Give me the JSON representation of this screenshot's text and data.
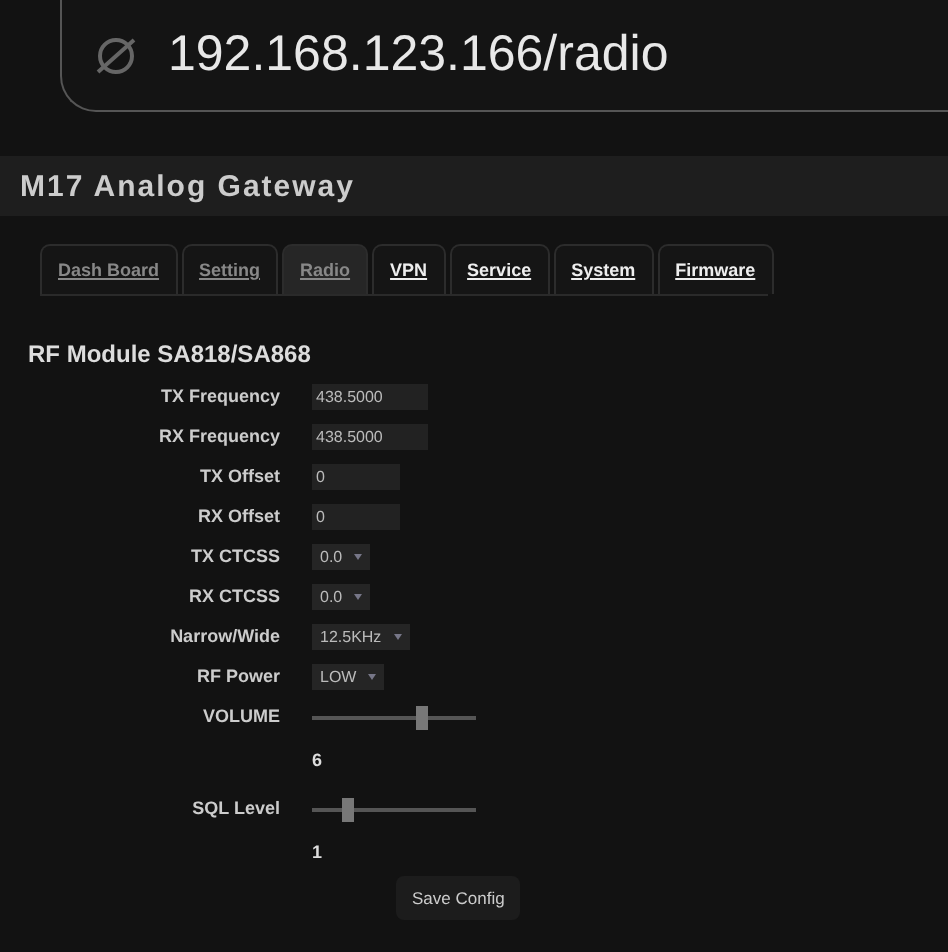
{
  "address_bar": {
    "url": "192.168.123.166/radio"
  },
  "header": {
    "title": "M17 Analog Gateway"
  },
  "tabs": [
    {
      "label": "Dash Board",
      "selected": false,
      "visited": true
    },
    {
      "label": "Setting",
      "selected": false,
      "visited": true
    },
    {
      "label": "Radio",
      "selected": true,
      "visited": true
    },
    {
      "label": "VPN",
      "selected": false,
      "visited": false
    },
    {
      "label": "Service",
      "selected": false,
      "visited": false
    },
    {
      "label": "System",
      "selected": false,
      "visited": false
    },
    {
      "label": "Firmware",
      "selected": false,
      "visited": false
    }
  ],
  "section": {
    "title": "RF Module SA818/SA868"
  },
  "fields": [
    {
      "kind": "text",
      "label": "TX Frequency",
      "value": "438.5000"
    },
    {
      "kind": "text",
      "label": "RX Frequency",
      "value": "438.5000"
    },
    {
      "kind": "text",
      "label": "TX Offset",
      "value": "0"
    },
    {
      "kind": "text",
      "label": "RX Offset",
      "value": "0"
    },
    {
      "kind": "select",
      "label": "TX CTCSS",
      "value": "0.0"
    },
    {
      "kind": "select",
      "label": "RX CTCSS",
      "value": "0.0"
    },
    {
      "kind": "select",
      "label": "Narrow/Wide",
      "value": "12.5KHz"
    },
    {
      "kind": "select",
      "label": "RF Power",
      "value": "LOW"
    },
    {
      "kind": "slider",
      "label": "VOLUME",
      "level": 0.67,
      "reading": "6"
    },
    {
      "kind": "slider",
      "label": "SQL Level",
      "level": 0.22,
      "reading": "1"
    }
  ],
  "buttons": [
    {
      "label": "Save Config"
    }
  ]
}
